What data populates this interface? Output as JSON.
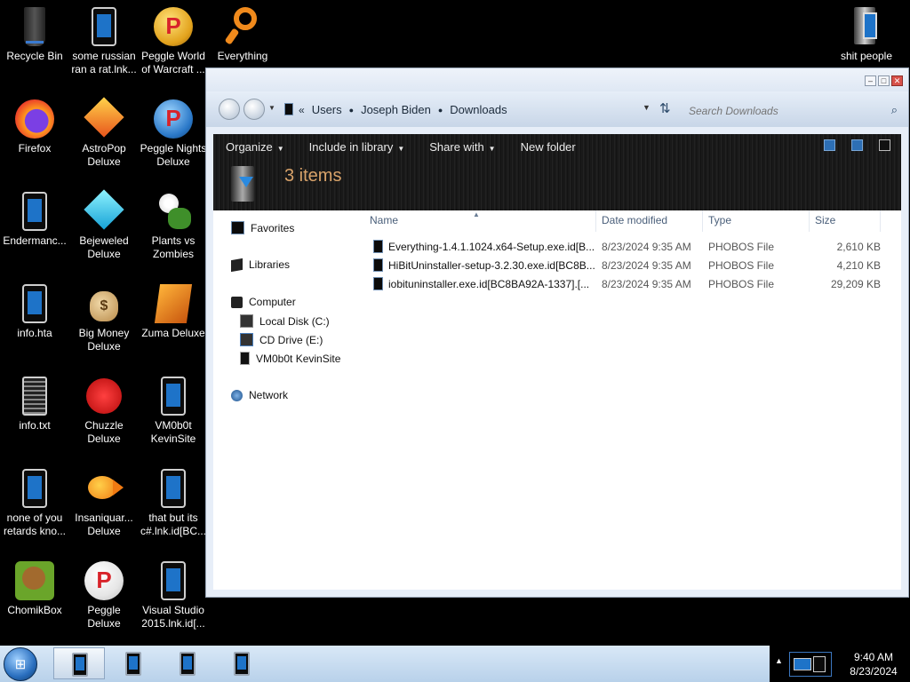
{
  "desktop": {
    "icons": [
      {
        "label": "Recycle Bin",
        "icon": "recycle-bin-icon"
      },
      {
        "label": "some russian\nran a rat.lnk...",
        "icon": "shortcut-icon"
      },
      {
        "label": "Peggle World\nof Warcraft ...",
        "icon": "peggle-icon"
      },
      {
        "label": "Everything",
        "icon": "magnifier-icon"
      },
      {
        "label": "Firefox",
        "icon": "firefox-icon"
      },
      {
        "label": "AstroPop\nDeluxe",
        "icon": "astropop-icon"
      },
      {
        "label": "Peggle Nights\nDeluxe",
        "icon": "peggle-nights-icon"
      },
      {
        "label": "Endermanc...",
        "icon": "shortcut-icon"
      },
      {
        "label": "Bejeweled\nDeluxe",
        "icon": "gem-icon"
      },
      {
        "label": "Plants vs\nZombies",
        "icon": "plant-icon"
      },
      {
        "label": "info.hta",
        "icon": "hta-icon"
      },
      {
        "label": "Big Money\nDeluxe",
        "icon": "money-bag-icon"
      },
      {
        "label": "Zuma Deluxe",
        "icon": "zuma-icon"
      },
      {
        "label": "info.txt",
        "icon": "text-file-icon"
      },
      {
        "label": "Chuzzle\nDeluxe",
        "icon": "chuzzle-icon"
      },
      {
        "label": "VM0b0t\nKevinSite",
        "icon": "shortcut-icon"
      },
      {
        "label": "none of you\nretards kno...",
        "icon": "shortcut-icon"
      },
      {
        "label": "Insaniquar...\nDeluxe",
        "icon": "fish-icon"
      },
      {
        "label": "that but its\nc#.lnk.id[BC...",
        "icon": "shortcut-icon"
      },
      {
        "label": "ChomikBox",
        "icon": "chomikbox-icon"
      },
      {
        "label": "Peggle Deluxe",
        "icon": "peggle-icon"
      },
      {
        "label": "Visual Studio\n2015.lnk.id[...",
        "icon": "shortcut-icon"
      },
      {
        "label": "shit people",
        "icon": "folder-icon"
      }
    ]
  },
  "explorer": {
    "breadcrumb": [
      "Users",
      "Joseph Biden",
      "Downloads"
    ],
    "search_placeholder": "Search Downloads",
    "toolbar": {
      "organize": "Organize",
      "include": "Include in library",
      "share": "Share with",
      "new_folder": "New folder"
    },
    "items_count": "3 items",
    "nav": {
      "favorites": "Favorites",
      "libraries": "Libraries",
      "computer": "Computer",
      "local_disk": "Local Disk (C:)",
      "cd_drive": "CD Drive (E:)",
      "vm": "VM0b0t KevinSite",
      "network": "Network"
    },
    "columns": {
      "name": "Name",
      "date": "Date modified",
      "type": "Type",
      "size": "Size"
    },
    "files": [
      {
        "name": "Everything-1.4.1.1024.x64-Setup.exe.id[B...",
        "date": "8/23/2024 9:35 AM",
        "type": "PHOBOS File",
        "size": "2,610 KB"
      },
      {
        "name": "HiBitUninstaller-setup-3.2.30.exe.id[BC8B...",
        "date": "8/23/2024 9:35 AM",
        "type": "PHOBOS File",
        "size": "4,210 KB"
      },
      {
        "name": "iobituninstaller.exe.id[BC8BA92A-1337].[...",
        "date": "8/23/2024 9:35 AM",
        "type": "PHOBOS File",
        "size": "29,209 KB"
      }
    ]
  },
  "taskbar": {
    "time": "9:40 AM",
    "date": "8/23/2024"
  }
}
